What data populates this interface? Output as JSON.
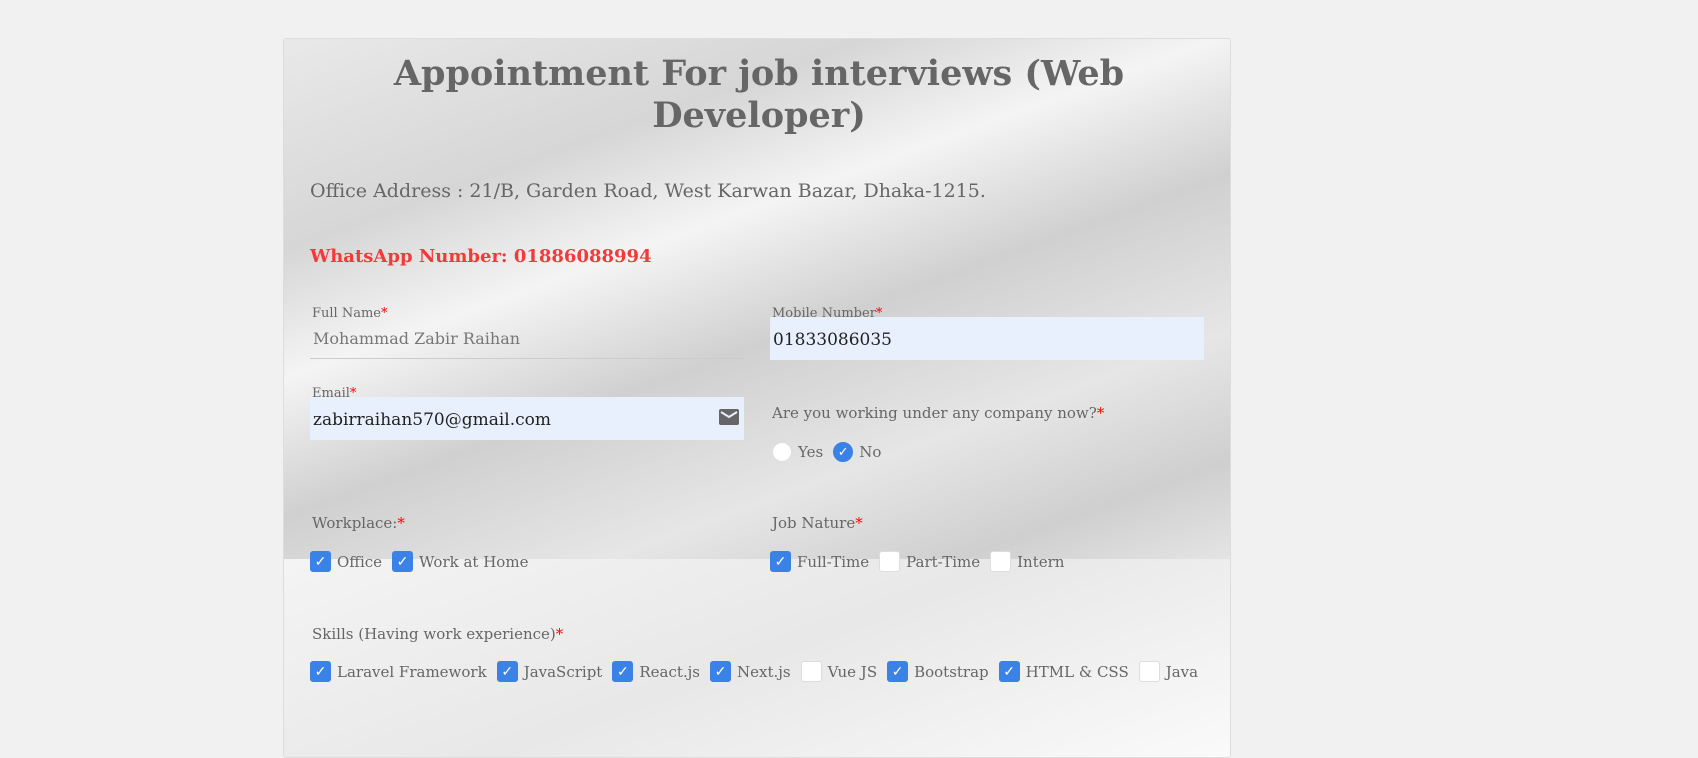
{
  "title": "Appointment For job interviews (Web Developer)",
  "office_address": "Office Address : 21/B, Garden Road, West Karwan Bazar, Dhaka-1215.",
  "whatsapp": "WhatsApp Number: 01886088994",
  "required_mark": "*",
  "full_name": {
    "label": "Full Name",
    "value": "Mohammad Zabir Raihan"
  },
  "mobile": {
    "label": "Mobile Number",
    "value": "01833086035"
  },
  "email": {
    "label": "Email",
    "value": "zabirraihan570@gmail.com"
  },
  "working": {
    "question": "Are you working under any company now?",
    "options": [
      {
        "label": "Yes",
        "checked": false
      },
      {
        "label": "No",
        "checked": true
      }
    ]
  },
  "workplace": {
    "label": "Workplace:",
    "options": [
      {
        "label": "Office",
        "checked": true
      },
      {
        "label": "Work at Home",
        "checked": true
      }
    ]
  },
  "job_nature": {
    "label": "Job Nature",
    "options": [
      {
        "label": "Full-Time",
        "checked": true
      },
      {
        "label": "Part-Time",
        "checked": false
      },
      {
        "label": "Intern",
        "checked": false
      }
    ]
  },
  "skills": {
    "label": "Skills (Having work experience)",
    "options": [
      {
        "label": "Laravel Framework",
        "checked": true
      },
      {
        "label": "JavaScript",
        "checked": true
      },
      {
        "label": "React.js",
        "checked": true
      },
      {
        "label": "Next.js",
        "checked": true
      },
      {
        "label": "Vue JS",
        "checked": false
      },
      {
        "label": "Bootstrap",
        "checked": true
      },
      {
        "label": "HTML & CSS",
        "checked": true
      },
      {
        "label": "Java",
        "checked": false
      }
    ]
  }
}
